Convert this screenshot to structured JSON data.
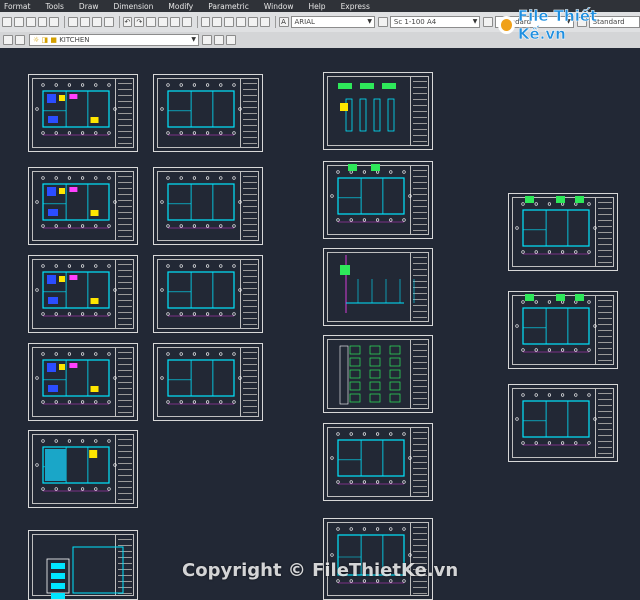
{
  "menu": [
    "Format",
    "Tools",
    "Draw",
    "Dimension",
    "Modify",
    "Parametric",
    "Window",
    "Help",
    "Express"
  ],
  "toolbar": {
    "text_style_font": "ARIAL",
    "dim_style": "Sc 1-100 A4",
    "table_style": "Standard",
    "multileader_style": "Standard",
    "layer_name": "KITCHEN"
  },
  "watermark": {
    "logo_text": "File Thiết Kế.vn",
    "copyright": "Copyright © FileThietKe.vn"
  },
  "colors": {
    "background": "#222835",
    "cyan": "#00e5ff",
    "yellow": "#ffe600",
    "green": "#2ee85a",
    "magenta": "#ff40ff",
    "blue": "#2b4dff",
    "red": "#ff3030"
  }
}
